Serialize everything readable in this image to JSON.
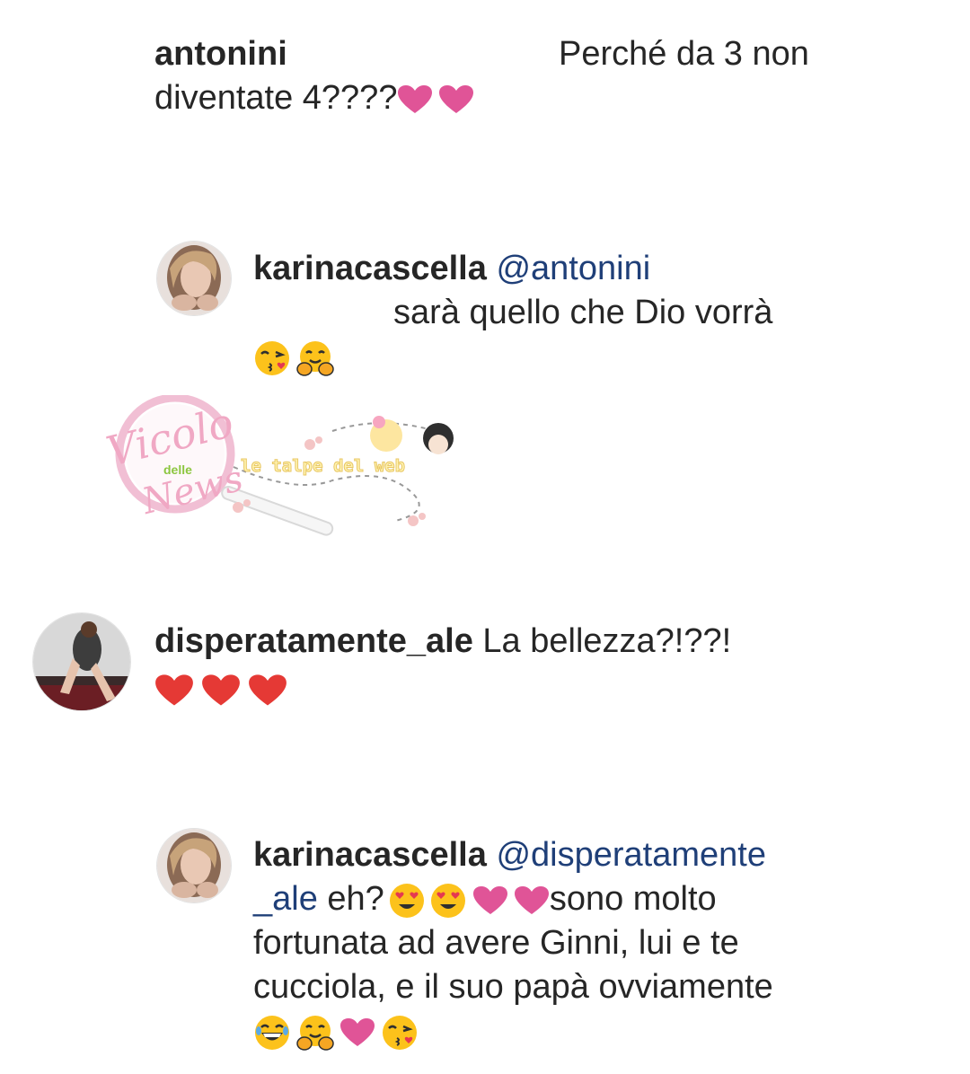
{
  "comments": [
    {
      "username": "antonini",
      "text_line1": "Perché da 3 non",
      "text_line2": "diventate 4????"
    },
    {
      "username": "karinacascella",
      "mention": "@antonini",
      "text_line1": "sarà quello che Dio vorrà"
    },
    {
      "username": "disperatamente_ale",
      "text_line1": "La bellezza?!??!"
    },
    {
      "username": "karinacascella",
      "mention_part1": "@disperatamente",
      "mention_part2": "_ale",
      "text_after_mention": " eh?",
      "text_after_emojis": "sono molto",
      "text_line3": "fortunata ad avere Ginni, lui e te",
      "text_line4": "cucciola, e il suo papà ovviamente"
    }
  ],
  "watermark": {
    "brand_line1": "Vicolo",
    "brand_line2": "delle",
    "brand_line3": "News",
    "tagline": "le talpe del web"
  },
  "icons": {
    "pink_heart": "pink-heart-icon",
    "red_heart": "red-heart-icon",
    "kiss_face": "kissing-face-icon",
    "hug_face": "hugging-face-icon",
    "heart_eyes": "heart-eyes-face-icon",
    "laugh_face": "laughing-face-icon"
  },
  "colors": {
    "mention": "#1f3f78",
    "pink_heart": "#e05497",
    "red_heart": "#e53935",
    "emoji_yellow": "#fcc21b"
  }
}
